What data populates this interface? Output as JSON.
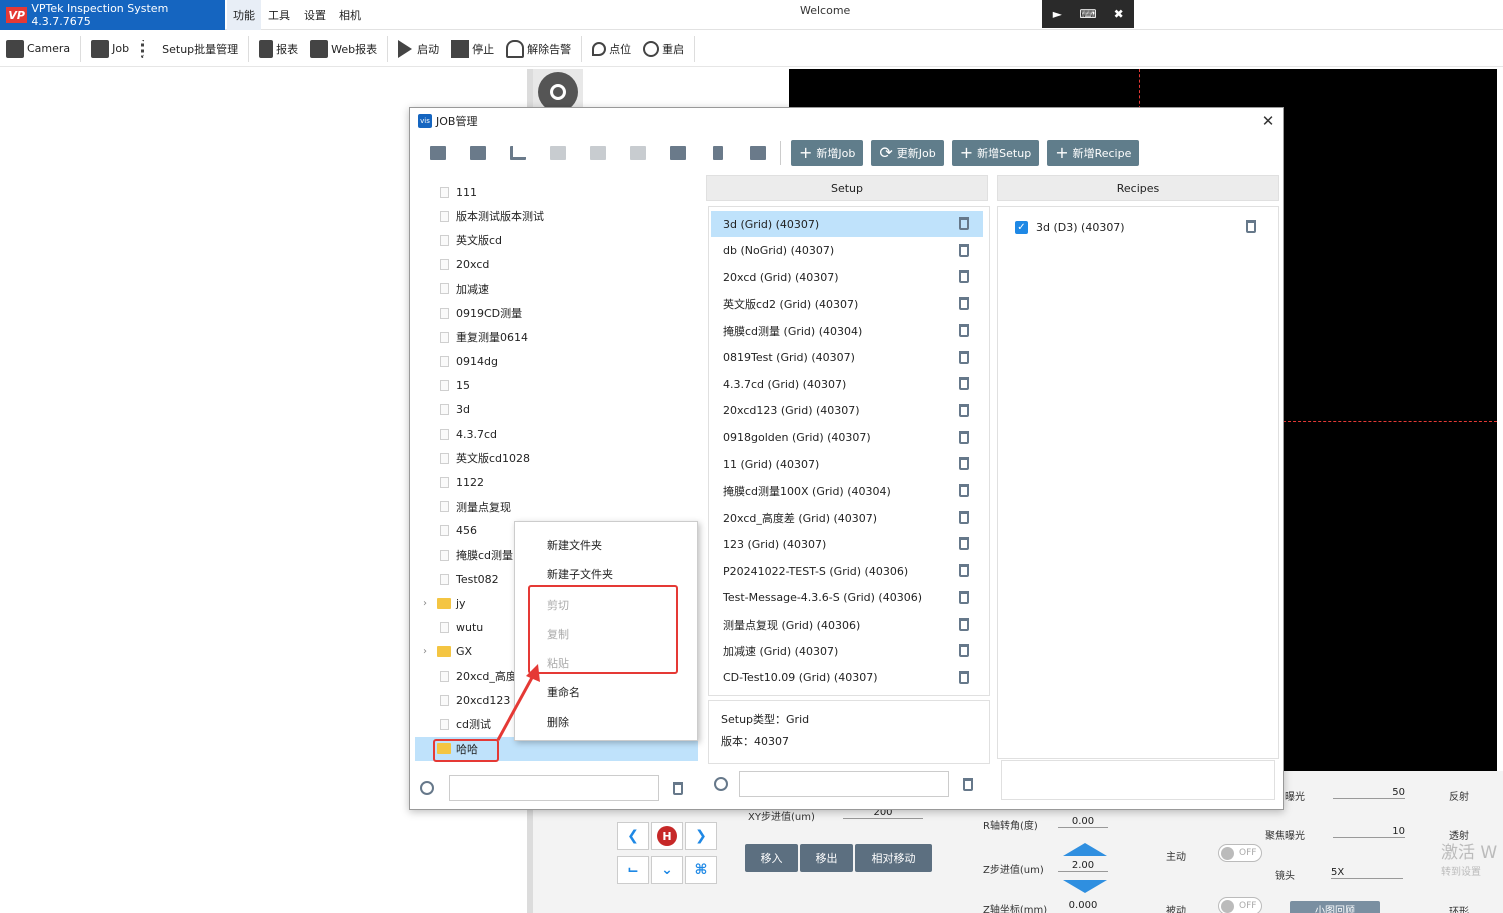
{
  "titlebar": {
    "app_title": "VPTek Inspection System 4.3.7.7675",
    "logo_text": "VP",
    "menus": [
      "功能",
      "工具",
      "设置",
      "相机"
    ],
    "welcome": "Welcome"
  },
  "toolbar": {
    "camera": "Camera",
    "job": "Job",
    "setup_batch": "Setup批量管理",
    "report": "报表",
    "web_report": "Web报表",
    "start": "启动",
    "stop": "停止",
    "clear_alarm": "解除告警",
    "point": "点位",
    "restart": "重启"
  },
  "dialog": {
    "title": "JOB管理",
    "logo": "vis",
    "actions": {
      "new_job": "新增Job",
      "update_job": "更新Job",
      "new_setup": "新增Setup",
      "new_recipe": "新增Recipe"
    },
    "tree": [
      {
        "label": "111",
        "type": "file"
      },
      {
        "label": "版本测试版本测试",
        "type": "file"
      },
      {
        "label": "英文版cd",
        "type": "file"
      },
      {
        "label": "20xcd",
        "type": "file"
      },
      {
        "label": "加减速",
        "type": "file"
      },
      {
        "label": "0919CD测量",
        "type": "file"
      },
      {
        "label": "重复测量0614",
        "type": "file"
      },
      {
        "label": "0914dg",
        "type": "file"
      },
      {
        "label": "15",
        "type": "file"
      },
      {
        "label": "3d",
        "type": "file"
      },
      {
        "label": "4.3.7cd",
        "type": "file"
      },
      {
        "label": "英文版cd1028",
        "type": "file"
      },
      {
        "label": "1122",
        "type": "file"
      },
      {
        "label": "测量点复现",
        "type": "file"
      },
      {
        "label": "456",
        "type": "file"
      },
      {
        "label": "掩膜cd测量",
        "type": "file"
      },
      {
        "label": "Test082",
        "type": "file"
      },
      {
        "label": "jy",
        "type": "folder"
      },
      {
        "label": "wutu",
        "type": "file"
      },
      {
        "label": "GX",
        "type": "folder"
      },
      {
        "label": "20xcd_高度差",
        "type": "file"
      },
      {
        "label": "20xcd123",
        "type": "file"
      },
      {
        "label": "cd测试",
        "type": "file"
      },
      {
        "label": "哈哈",
        "type": "folder",
        "selected": true
      }
    ],
    "setup_header": "Setup",
    "recipes_header": "Recipes",
    "setups": [
      "3d (Grid) (40307)",
      "db (NoGrid) (40307)",
      "20xcd (Grid) (40307)",
      "英文版cd2 (Grid) (40307)",
      "掩膜cd测量 (Grid) (40304)",
      "0819Test (Grid) (40307)",
      "4.3.7cd (Grid) (40307)",
      "20xcd123 (Grid) (40307)",
      "0918golden (Grid) (40307)",
      "11 (Grid) (40307)",
      "掩膜cd测量100X (Grid) (40304)",
      "20xcd_高度差 (Grid) (40307)",
      "123 (Grid) (40307)",
      "P20241022-TEST-S (Grid) (40306)",
      "Test-Message-4.3.6-S (Grid) (40306)",
      "测量点复现 (Grid) (40306)",
      "加减速 (Grid) (40307)",
      "CD-Test10.09 (Grid) (40307)"
    ],
    "setup_info": {
      "type_line": "Setup类型：Grid",
      "version_line": "版本：40307"
    },
    "recipes": [
      {
        "label": "3d (D3) (40307)",
        "checked": true
      }
    ]
  },
  "context_menu": {
    "items": [
      {
        "label": "新建文件夹",
        "enabled": true
      },
      {
        "label": "新建子文件夹",
        "enabled": true
      },
      {
        "label": "剪切",
        "enabled": false
      },
      {
        "label": "复制",
        "enabled": false
      },
      {
        "label": "粘贴",
        "enabled": false
      },
      {
        "label": "重命名",
        "enabled": true
      },
      {
        "label": "删除",
        "enabled": true
      }
    ]
  },
  "bottom_panel": {
    "xy_step_label": "XY步进值(um)",
    "xy_step_value": "200",
    "home_label": "H",
    "move_in": "移入",
    "move_out": "移出",
    "relative_move": "相对移动",
    "r_axis_label": "R轴转角(度)",
    "r_axis_value": "0.00",
    "z_step_label": "Z步进值(um)",
    "z_step_value": "2.00",
    "z_coord_label": "Z轴坐标(mm)",
    "z_coord_value": "0.000",
    "exposure_label": "曝光",
    "exposure_value": "50",
    "focus_exposure_label": "聚焦曝光",
    "focus_exposure_value": "10",
    "active_label": "主动",
    "passive_label": "被动",
    "toggle_off": "OFF",
    "lens_label": "镜头",
    "lens_value": "5X",
    "reflect_label": "反射",
    "transmit_label": "透射",
    "light_label": "光",
    "ring_label": "环形",
    "activate_text": "激活 W",
    "settings_text": "转到设置",
    "small_map": "小图回顾"
  }
}
